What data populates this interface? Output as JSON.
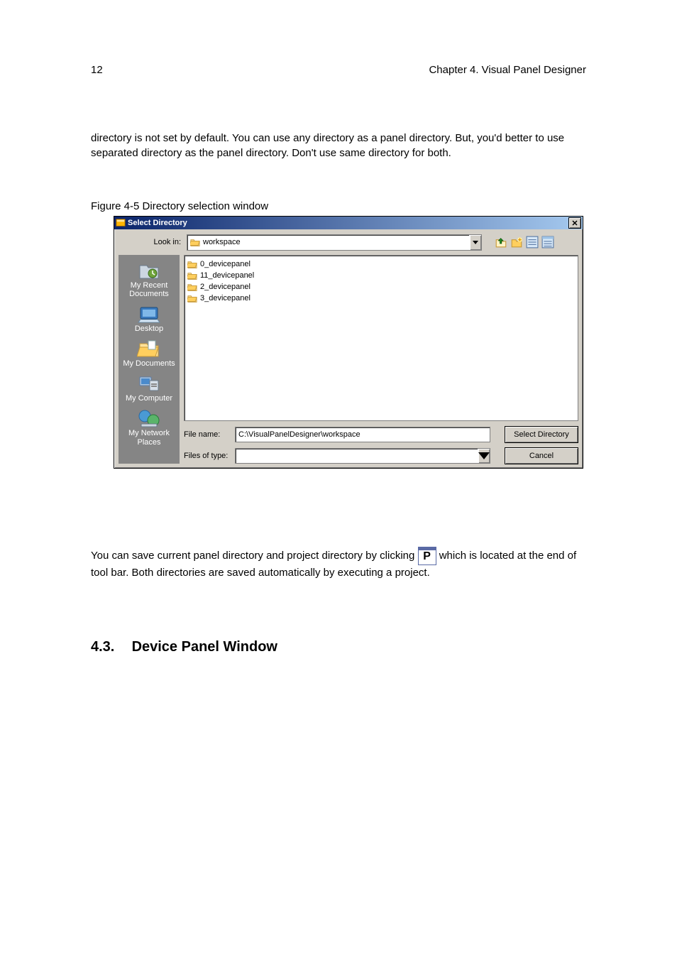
{
  "page": {
    "number": "12",
    "header_right": "Chapter 4. Visual Panel Designer"
  },
  "doc": {
    "para1": "directory is not set by default.  You can use any directory as  a panel directory. But, you'd better to use separated directory as the panel directory. Don't use same directory for both.",
    "fig_caption1": "Figure 4-5 Directory selection window",
    "para2a": "You can save current panel directory and project directory by clicking ",
    "para2b": " which is located at the end of tool bar. Both directories are saved automatically by executing a project."
  },
  "section": {
    "num": "4.3.",
    "title": "Device Panel Window"
  },
  "dialog": {
    "title": "Select Directory",
    "lookin_label": "Look in:",
    "lookin_value": "workspace",
    "files": [
      {
        "name": "0_devicepanel"
      },
      {
        "name": "11_devicepanel"
      },
      {
        "name": "2_devicepanel"
      },
      {
        "name": "3_devicepanel"
      }
    ],
    "file_name_label": "File name:",
    "file_name_value": "C:\\VisualPanelDesigner\\workspace",
    "file_type_label": "Files of type:",
    "file_type_value": "",
    "primary_btn": "Select Directory",
    "cancel_btn": "Cancel",
    "places": [
      "My Recent Documents",
      "Desktop",
      "My Documents",
      "My Computer",
      "My Network Places"
    ]
  }
}
